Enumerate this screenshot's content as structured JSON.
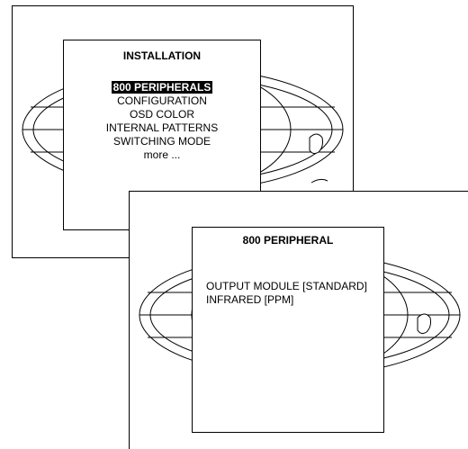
{
  "screen1": {
    "title": "INSTALLATION",
    "items": [
      {
        "label": "800 PERIPHERALS",
        "selected": true
      },
      {
        "label": "CONFIGURATION",
        "selected": false
      },
      {
        "label": "OSD COLOR",
        "selected": false
      },
      {
        "label": "INTERNAL PATTERNS",
        "selected": false
      },
      {
        "label": "SWITCHING MODE",
        "selected": false
      },
      {
        "label": "more ...",
        "selected": false
      }
    ]
  },
  "screen2": {
    "title": "800 PERIPHERAL",
    "items": [
      {
        "label": "OUTPUT MODULE [STANDARD]"
      },
      {
        "label": "INFRARED [PPM]"
      }
    ]
  },
  "icons": {
    "background_graphic": "globe-icon"
  }
}
